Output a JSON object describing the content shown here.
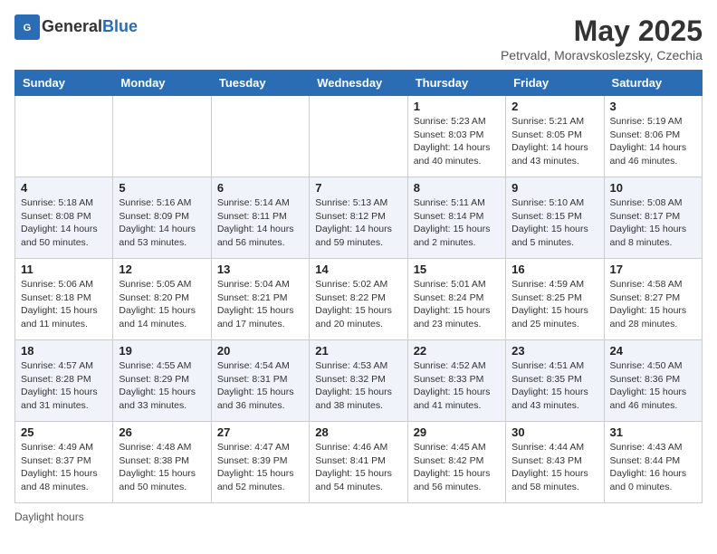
{
  "header": {
    "logo_text_general": "General",
    "logo_text_blue": "Blue",
    "month_title": "May 2025",
    "subtitle": "Petrvald, Moravskoslezsky, Czechia"
  },
  "days_of_week": [
    "Sunday",
    "Monday",
    "Tuesday",
    "Wednesday",
    "Thursday",
    "Friday",
    "Saturday"
  ],
  "footer": {
    "daylight_label": "Daylight hours"
  },
  "weeks": [
    [
      {
        "day": "",
        "detail": ""
      },
      {
        "day": "",
        "detail": ""
      },
      {
        "day": "",
        "detail": ""
      },
      {
        "day": "",
        "detail": ""
      },
      {
        "day": "1",
        "detail": "Sunrise: 5:23 AM\nSunset: 8:03 PM\nDaylight: 14 hours\nand 40 minutes."
      },
      {
        "day": "2",
        "detail": "Sunrise: 5:21 AM\nSunset: 8:05 PM\nDaylight: 14 hours\nand 43 minutes."
      },
      {
        "day": "3",
        "detail": "Sunrise: 5:19 AM\nSunset: 8:06 PM\nDaylight: 14 hours\nand 46 minutes."
      }
    ],
    [
      {
        "day": "4",
        "detail": "Sunrise: 5:18 AM\nSunset: 8:08 PM\nDaylight: 14 hours\nand 50 minutes."
      },
      {
        "day": "5",
        "detail": "Sunrise: 5:16 AM\nSunset: 8:09 PM\nDaylight: 14 hours\nand 53 minutes."
      },
      {
        "day": "6",
        "detail": "Sunrise: 5:14 AM\nSunset: 8:11 PM\nDaylight: 14 hours\nand 56 minutes."
      },
      {
        "day": "7",
        "detail": "Sunrise: 5:13 AM\nSunset: 8:12 PM\nDaylight: 14 hours\nand 59 minutes."
      },
      {
        "day": "8",
        "detail": "Sunrise: 5:11 AM\nSunset: 8:14 PM\nDaylight: 15 hours\nand 2 minutes."
      },
      {
        "day": "9",
        "detail": "Sunrise: 5:10 AM\nSunset: 8:15 PM\nDaylight: 15 hours\nand 5 minutes."
      },
      {
        "day": "10",
        "detail": "Sunrise: 5:08 AM\nSunset: 8:17 PM\nDaylight: 15 hours\nand 8 minutes."
      }
    ],
    [
      {
        "day": "11",
        "detail": "Sunrise: 5:06 AM\nSunset: 8:18 PM\nDaylight: 15 hours\nand 11 minutes."
      },
      {
        "day": "12",
        "detail": "Sunrise: 5:05 AM\nSunset: 8:20 PM\nDaylight: 15 hours\nand 14 minutes."
      },
      {
        "day": "13",
        "detail": "Sunrise: 5:04 AM\nSunset: 8:21 PM\nDaylight: 15 hours\nand 17 minutes."
      },
      {
        "day": "14",
        "detail": "Sunrise: 5:02 AM\nSunset: 8:22 PM\nDaylight: 15 hours\nand 20 minutes."
      },
      {
        "day": "15",
        "detail": "Sunrise: 5:01 AM\nSunset: 8:24 PM\nDaylight: 15 hours\nand 23 minutes."
      },
      {
        "day": "16",
        "detail": "Sunrise: 4:59 AM\nSunset: 8:25 PM\nDaylight: 15 hours\nand 25 minutes."
      },
      {
        "day": "17",
        "detail": "Sunrise: 4:58 AM\nSunset: 8:27 PM\nDaylight: 15 hours\nand 28 minutes."
      }
    ],
    [
      {
        "day": "18",
        "detail": "Sunrise: 4:57 AM\nSunset: 8:28 PM\nDaylight: 15 hours\nand 31 minutes."
      },
      {
        "day": "19",
        "detail": "Sunrise: 4:55 AM\nSunset: 8:29 PM\nDaylight: 15 hours\nand 33 minutes."
      },
      {
        "day": "20",
        "detail": "Sunrise: 4:54 AM\nSunset: 8:31 PM\nDaylight: 15 hours\nand 36 minutes."
      },
      {
        "day": "21",
        "detail": "Sunrise: 4:53 AM\nSunset: 8:32 PM\nDaylight: 15 hours\nand 38 minutes."
      },
      {
        "day": "22",
        "detail": "Sunrise: 4:52 AM\nSunset: 8:33 PM\nDaylight: 15 hours\nand 41 minutes."
      },
      {
        "day": "23",
        "detail": "Sunrise: 4:51 AM\nSunset: 8:35 PM\nDaylight: 15 hours\nand 43 minutes."
      },
      {
        "day": "24",
        "detail": "Sunrise: 4:50 AM\nSunset: 8:36 PM\nDaylight: 15 hours\nand 46 minutes."
      }
    ],
    [
      {
        "day": "25",
        "detail": "Sunrise: 4:49 AM\nSunset: 8:37 PM\nDaylight: 15 hours\nand 48 minutes."
      },
      {
        "day": "26",
        "detail": "Sunrise: 4:48 AM\nSunset: 8:38 PM\nDaylight: 15 hours\nand 50 minutes."
      },
      {
        "day": "27",
        "detail": "Sunrise: 4:47 AM\nSunset: 8:39 PM\nDaylight: 15 hours\nand 52 minutes."
      },
      {
        "day": "28",
        "detail": "Sunrise: 4:46 AM\nSunset: 8:41 PM\nDaylight: 15 hours\nand 54 minutes."
      },
      {
        "day": "29",
        "detail": "Sunrise: 4:45 AM\nSunset: 8:42 PM\nDaylight: 15 hours\nand 56 minutes."
      },
      {
        "day": "30",
        "detail": "Sunrise: 4:44 AM\nSunset: 8:43 PM\nDaylight: 15 hours\nand 58 minutes."
      },
      {
        "day": "31",
        "detail": "Sunrise: 4:43 AM\nSunset: 8:44 PM\nDaylight: 16 hours\nand 0 minutes."
      }
    ]
  ]
}
